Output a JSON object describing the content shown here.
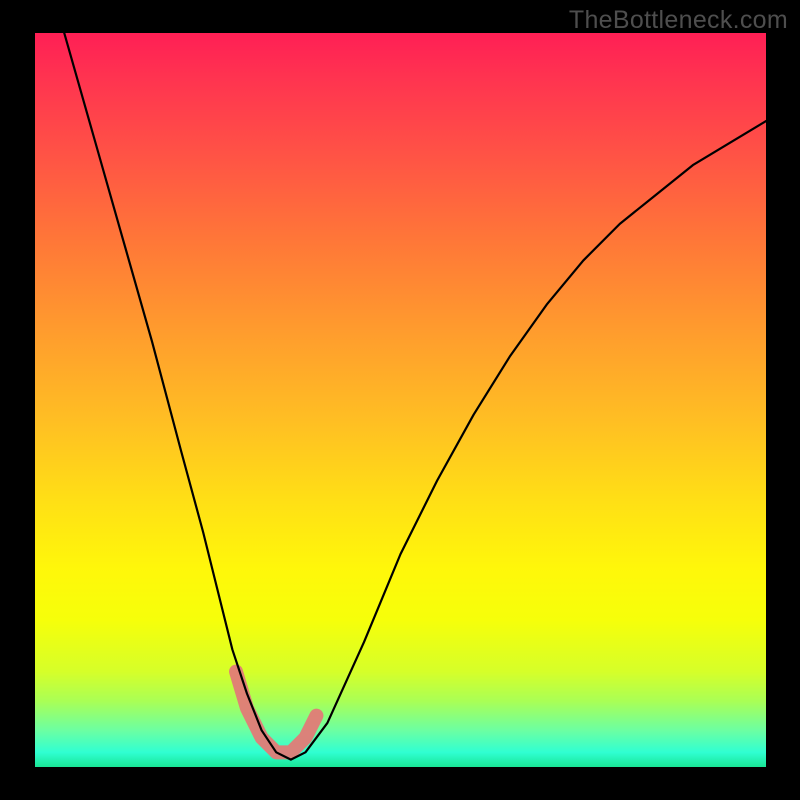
{
  "watermark": "TheBottleneck.com",
  "colors": {
    "frame": "#000000",
    "curve": "#000000",
    "band": "#e27b77"
  },
  "chart_data": {
    "type": "line",
    "title": "",
    "xlabel": "",
    "ylabel": "",
    "xlim": [
      0,
      100
    ],
    "ylim": [
      0,
      100
    ],
    "series": [
      {
        "name": "bottleneck-curve",
        "x": [
          4,
          8,
          12,
          16,
          20,
          23,
          25,
          27,
          29,
          31,
          33,
          35,
          37,
          40,
          45,
          50,
          55,
          60,
          65,
          70,
          75,
          80,
          85,
          90,
          95,
          100
        ],
        "y": [
          100,
          86,
          72,
          58,
          43,
          32,
          24,
          16,
          10,
          5,
          2,
          1,
          2,
          6,
          17,
          29,
          39,
          48,
          56,
          63,
          69,
          74,
          78,
          82,
          85,
          88
        ]
      }
    ],
    "highlight_band": {
      "name": "optimal-zone",
      "x": [
        27.5,
        29,
        31,
        33,
        35,
        37,
        38.5
      ],
      "y": [
        13,
        8,
        4,
        2,
        2,
        4,
        7
      ]
    },
    "gradient_stops": [
      {
        "pos": 0,
        "color": "#ff1f55"
      },
      {
        "pos": 17,
        "color": "#ff5445"
      },
      {
        "pos": 40,
        "color": "#ff9a2e"
      },
      {
        "pos": 64,
        "color": "#ffe015"
      },
      {
        "pos": 80,
        "color": "#f6ff0a"
      },
      {
        "pos": 95,
        "color": "#6cffa2"
      },
      {
        "pos": 100,
        "color": "#19e696"
      }
    ]
  }
}
